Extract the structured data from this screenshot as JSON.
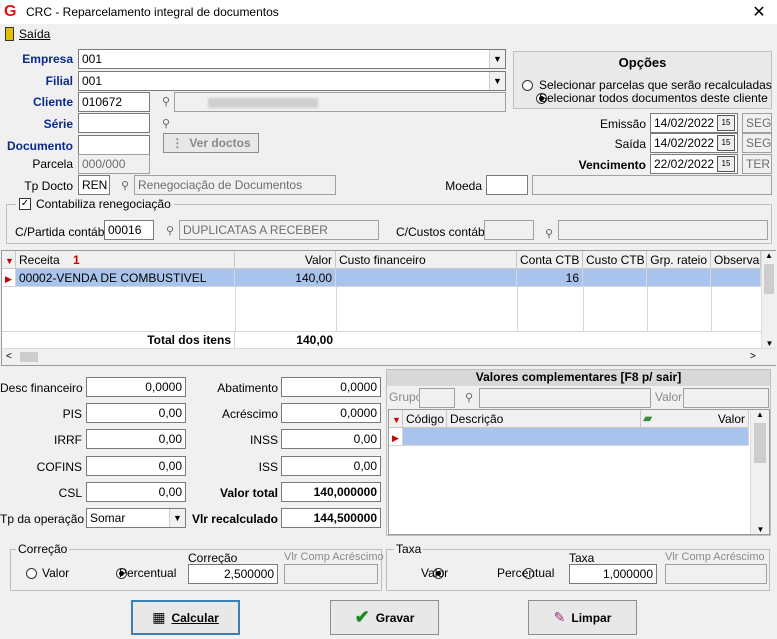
{
  "window": {
    "title": "CRC - Reparcelamento integral de documentos",
    "close": "✕"
  },
  "menu": {
    "saida": "Saída"
  },
  "labels": {
    "empresa": "Empresa",
    "filial": "Filial",
    "cliente": "Cliente",
    "serie": "Série",
    "documento": "Documento",
    "parcela": "Parcela",
    "tp_docto": "Tp Docto",
    "contabiliza": "Contabiliza renegociação",
    "cpartida": "C/Partida contábil",
    "ccustos": "C/Custos contábil",
    "emissao": "Emissão",
    "saida": "Saída",
    "vencimento": "Vencimento",
    "moeda": "Moeda",
    "ver_doctos": "Ver doctos"
  },
  "fields": {
    "empresa": "001",
    "filial": "001",
    "cliente": "010672",
    "parcela": "000/000",
    "tp_docto": "REN",
    "tp_docto_desc": "Renegociação de Documentos",
    "cpartida": "00016",
    "cpartida_desc": "DUPLICATAS A RECEBER",
    "emissao": "14/02/2022",
    "emissao_day": "SEG",
    "saida": "14/02/2022",
    "saida_day": "SEG",
    "vencimento": "22/02/2022",
    "vencimento_day": "TER"
  },
  "opcoes": {
    "title": "Opções",
    "opt1": "Selecionar parcelas que serão recalculadas",
    "opt2": "Selecionar todos documentos deste cliente"
  },
  "grid1": {
    "headers": [
      "Receita",
      "Valor",
      "Custo financeiro",
      "Conta CTB",
      "Custo CTB",
      "Grp. rateio",
      "Observaç"
    ],
    "sort_indicator": "1",
    "row": {
      "receita": "00002-VENDA DE COMBUSTIVEL",
      "valor": "140,00",
      "conta_ctb": "16"
    },
    "total_label": "Total dos itens",
    "total_value": "140,00"
  },
  "valores": {
    "desc_financeiro": {
      "label": "Desc financeiro",
      "value": "0,0000"
    },
    "pis": {
      "label": "PIS",
      "value": "0,00"
    },
    "irrf": {
      "label": "IRRF",
      "value": "0,00"
    },
    "cofins": {
      "label": "COFINS",
      "value": "0,00"
    },
    "csl": {
      "label": "CSL",
      "value": "0,00"
    },
    "tp_operacao": {
      "label": "Tp da operação",
      "value": "Somar"
    },
    "abatimento": {
      "label": "Abatimento",
      "value": "0,0000"
    },
    "acrescimo": {
      "label": "Acréscimo",
      "value": "0,0000"
    },
    "inss": {
      "label": "INSS",
      "value": "0,00"
    },
    "iss": {
      "label": "ISS",
      "value": "0,00"
    },
    "valor_total": {
      "label": "Valor total",
      "value": "140,000000"
    },
    "vlr_recalculado": {
      "label": "Vlr recalculado",
      "value": "144,500000"
    }
  },
  "complementares": {
    "title": "Valores complementares [F8 p/ sair]",
    "grupo": "Grupo",
    "valor": "Valor",
    "headers": [
      "Código",
      "Descrição",
      "Valor"
    ]
  },
  "correcao": {
    "title": "Correção",
    "opt_valor": "Valor",
    "opt_percentual": "Percentual",
    "field_label": "Correção",
    "field_value": "2,500000",
    "comp_label": "Vlr Comp Acréscimo"
  },
  "taxa": {
    "title": "Taxa",
    "opt_valor": "Valor",
    "opt_percentual": "Percentual",
    "field_label": "Taxa",
    "field_value": "1,000000",
    "comp_label": "Vlr Comp Acréscimo"
  },
  "buttons": {
    "calcular": "Calcular",
    "gravar": "Gravar",
    "limpar": "Limpar"
  },
  "colors": {
    "accent": "#0a2a8a",
    "selection": "#a9c4ec",
    "brand": "#d11111"
  }
}
